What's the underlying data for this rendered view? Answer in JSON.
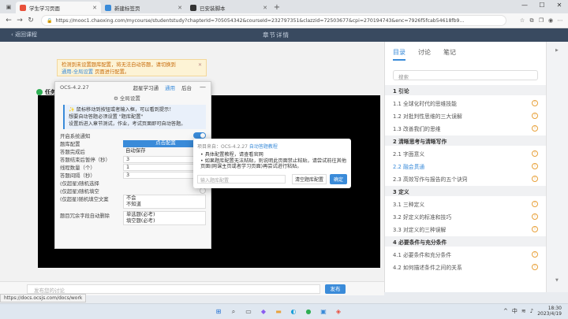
{
  "browser": {
    "tabs": [
      {
        "title": "学生学习页面",
        "active": true,
        "color": "#e8503a"
      },
      {
        "title": "新建标签页",
        "active": false,
        "color": "#3a8bd9"
      },
      {
        "title": "已安装脚本",
        "active": false,
        "color": "#333333"
      }
    ],
    "url": "https://mooc1.chaoxing.com/mycourse/studentstudy?chapterId=705054342&courseId=232797351&clazzid=72503677&cpi=270194743&enc=7926f5fcab54618fb9..."
  },
  "site": {
    "back_label": "返回课程",
    "title": "章节详情"
  },
  "warning": {
    "line1": "检测到未设置题库配置，将无法自动答题，请切换到",
    "link": "通用-全局设置",
    "line2": "页面进行配置。"
  },
  "main": {
    "task_label": "任务"
  },
  "ocs": {
    "version": "OCS-4.2.27",
    "tabs": [
      "超星学习通",
      "通用",
      "后台"
    ],
    "active_tab": "通用",
    "minimize": "—",
    "section_title": "全局设置",
    "tips": [
      "✨ 鼠标移动到按钮或者输入框，可以看到提示！",
      "想要自动答题必须设置 \"题库配置\"",
      "设置后进入章节测试，作业，考试页面即可自动答题。"
    ],
    "rows": {
      "system_notify": "开启系统通知",
      "qa_config": "题库配置",
      "qa_config_btn": "点击配置",
      "after_complete": "答题完成后",
      "after_complete_val": "自动保存",
      "pause_label": "答题结束后暂停（秒）",
      "pause_val": "3",
      "threads_label": "线程数量（个）",
      "threads_val": "1",
      "interval_label": "答题间隔（秒）",
      "interval_val": "3",
      "select_label": "(仅超星)随机选择",
      "judge_label": "(仅超星)随机填空",
      "fill_label": "(仅超星)随机填空文案",
      "fill_options": [
        "不会",
        "不知道"
      ],
      "extra_label": "题目冗余字段自动删除",
      "extra_options": [
        "单选题(必考)",
        "填空题(必考)"
      ]
    }
  },
  "dialog": {
    "source_prefix": "项目来自：OCS-4.2.27",
    "source_link": "自动答题教程",
    "items": [
      "具体配置教程，请查看官网",
      "如果题库配置无法粘贴，则说明此页面禁止粘贴，请尝试前往其他页面(网课主页或者学习页面)再尝试进行粘贴。"
    ],
    "input_placeholder": "输入题库配置",
    "clear_btn": "清空题库配置",
    "confirm_btn": "确定"
  },
  "sidebar": {
    "tabs": [
      "目录",
      "讨论",
      "笔记"
    ],
    "active_tab": "目录",
    "search_placeholder": "搜索",
    "chapters": [
      {
        "label": "1 引论",
        "kind": "head"
      },
      {
        "label": "1.1 全球化时代的思维技能",
        "kind": "sub"
      },
      {
        "label": "1.2 对批判性思维的三大误解",
        "kind": "sub"
      },
      {
        "label": "1.3 改善我们的思维",
        "kind": "sub"
      },
      {
        "label": "2 清晰思考与清晰写作",
        "kind": "head"
      },
      {
        "label": "2.1 字面意义",
        "kind": "sub"
      },
      {
        "label": "2.2 融会贯通",
        "kind": "sub",
        "current": true
      },
      {
        "label": "2.3 高效写作与报告的五个诀窍",
        "kind": "sub"
      },
      {
        "label": "3 定义",
        "kind": "head"
      },
      {
        "label": "3.1 三种定义",
        "kind": "sub"
      },
      {
        "label": "3.2 好定义的标准和技巧",
        "kind": "sub"
      },
      {
        "label": "3.3 对定义的三种误解",
        "kind": "sub"
      },
      {
        "label": "4 必要条件与充分条件",
        "kind": "head"
      },
      {
        "label": "4.1 必要条件和充分条件",
        "kind": "sub"
      },
      {
        "label": "4.2 如何描述条件之间的关系",
        "kind": "sub"
      }
    ],
    "pending_mark": "!"
  },
  "bottom": {
    "discuss_placeholder": "发布您的讨论",
    "post_btn": "发布",
    "status_url": "https://docs.ocsjs.com/docs/work"
  },
  "taskbar": {
    "tray_lang": "中",
    "time": "18:30",
    "date": "2023/4/19"
  }
}
